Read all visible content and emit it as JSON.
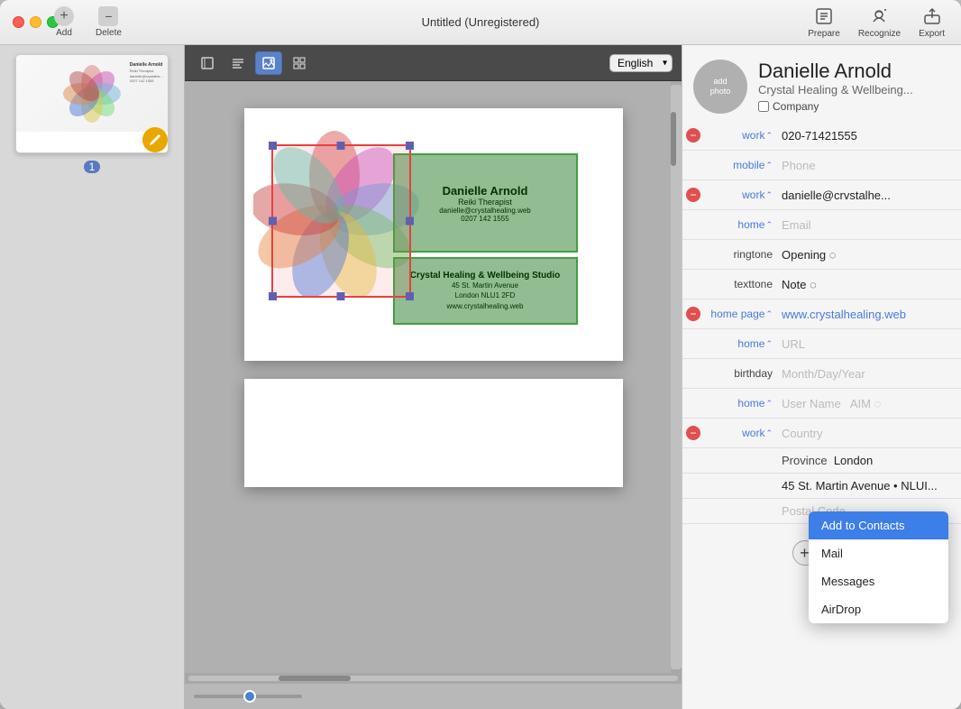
{
  "window": {
    "title": "Untitled (Unregistered)"
  },
  "toolbar": {
    "add_label": "Add",
    "delete_label": "Delete",
    "prepare_label": "Prepare",
    "recognize_label": "Recognize",
    "export_label": "Export"
  },
  "canvas_toolbar": {
    "tools": [
      {
        "id": "select",
        "icon": "⊡",
        "active": false
      },
      {
        "id": "text",
        "icon": "☰",
        "active": false
      },
      {
        "id": "image",
        "icon": "▣",
        "active": true
      },
      {
        "id": "grid",
        "icon": "⊞",
        "active": false
      }
    ],
    "language": "English"
  },
  "sidebar": {
    "page_number": "1"
  },
  "business_card": {
    "front_name": "Danielle Arnold",
    "front_title": "Reiki Therapist",
    "front_email": "danielle@crystalhealing.web",
    "front_phone": "0207 142 1555",
    "company_name": "Crystal Healing & Wellbeing Studio",
    "company_addr_1": "45 St. Martin Avenue",
    "company_addr_2": "London NLU1 2FD",
    "company_url": "www.crystalhealing.web"
  },
  "contact": {
    "add_photo_label": "add\nphoto",
    "name": "Danielle Arnold",
    "company": "Crystal Healing & Wellbeing...",
    "company_checkbox_label": "Company",
    "fields": [
      {
        "has_remove": true,
        "label": "work",
        "has_stepper": true,
        "value": "020-71421555",
        "placeholder": false
      },
      {
        "has_remove": false,
        "label": "mobile",
        "has_stepper": true,
        "value": "Phone",
        "placeholder": true
      },
      {
        "has_remove": true,
        "label": "work",
        "has_stepper": true,
        "value": "danielle@crvstalhe...",
        "placeholder": false
      },
      {
        "has_remove": false,
        "label": "home",
        "has_stepper": true,
        "value": "Email",
        "placeholder": true
      },
      {
        "has_remove": false,
        "label": "ringtone",
        "has_stepper": false,
        "value": "Opening ◌",
        "placeholder": false
      },
      {
        "has_remove": false,
        "label": "texttone",
        "has_stepper": false,
        "value": "Note ◌",
        "placeholder": false
      },
      {
        "has_remove": true,
        "label": "home page",
        "has_stepper": true,
        "value": "www.crystalhealing.web",
        "placeholder": false,
        "link": true
      },
      {
        "has_remove": false,
        "label": "home",
        "has_stepper": true,
        "value": "URL",
        "placeholder": true
      },
      {
        "has_remove": false,
        "label": "birthday",
        "has_stepper": false,
        "value": "Month/Day/Year",
        "placeholder": true
      },
      {
        "has_remove": false,
        "label": "home",
        "has_stepper": true,
        "value": "User Name  AIM ◌",
        "placeholder": true
      },
      {
        "has_remove": true,
        "label": "work",
        "has_stepper": true,
        "value": "Country",
        "placeholder": true
      },
      {
        "has_remove": false,
        "label": "",
        "has_stepper": false,
        "value": "Province  London",
        "placeholder": false
      },
      {
        "has_remove": false,
        "label": "",
        "has_stepper": false,
        "value": "45 St. Martin Avenue • NLUI...",
        "placeholder": false
      },
      {
        "has_remove": false,
        "label": "",
        "has_stepper": false,
        "value": "Postal Code",
        "placeholder": true
      }
    ]
  },
  "share_dropdown": {
    "items": [
      {
        "label": "Add to Contacts",
        "active": true
      },
      {
        "label": "Mail",
        "active": false
      },
      {
        "label": "Messages",
        "active": false
      },
      {
        "label": "AirDrop",
        "active": false
      }
    ]
  },
  "panel_buttons": {
    "add_label": "+",
    "share_label": "⤴"
  }
}
